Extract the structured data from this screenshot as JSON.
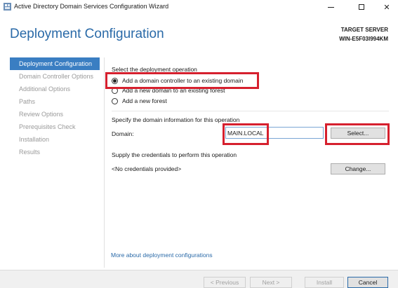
{
  "window": {
    "title": "Active Directory Domain Services Configuration Wizard",
    "minimize_icon": "minimize-icon",
    "maximize_icon": "maximize-icon",
    "close_glyph": "✕"
  },
  "header": {
    "title": "Deployment Configuration",
    "target_label": "TARGET SERVER",
    "target_name": "WIN-E5F03I994KM"
  },
  "sidebar": {
    "items": [
      {
        "label": "Deployment Configuration",
        "active": true
      },
      {
        "label": "Domain Controller Options",
        "active": false
      },
      {
        "label": "Additional Options",
        "active": false
      },
      {
        "label": "Paths",
        "active": false
      },
      {
        "label": "Review Options",
        "active": false
      },
      {
        "label": "Prerequisites Check",
        "active": false
      },
      {
        "label": "Installation",
        "active": false
      },
      {
        "label": "Results",
        "active": false
      }
    ]
  },
  "main": {
    "operation_heading": "Select the deployment operation",
    "options": [
      {
        "label": "Add a domain controller to an existing domain",
        "checked": true
      },
      {
        "label": "Add a new domain to an existing forest",
        "checked": false
      },
      {
        "label": "Add a new forest",
        "checked": false
      }
    ],
    "domain_heading": "Specify the domain information for this operation",
    "domain_label": "Domain:",
    "domain_value": "MAIN.LOCAL",
    "select_button": "Select...",
    "credentials_heading": "Supply the credentials to perform this operation",
    "credentials_value": "<No credentials provided>",
    "change_button": "Change...",
    "more_link": "More about deployment configurations"
  },
  "footer": {
    "previous": "< Previous",
    "next": "Next >",
    "install": "Install",
    "cancel": "Cancel"
  },
  "colors": {
    "accent": "#2a6aa8",
    "active_nav": "#3a7ec2",
    "highlight": "#d6202e"
  }
}
